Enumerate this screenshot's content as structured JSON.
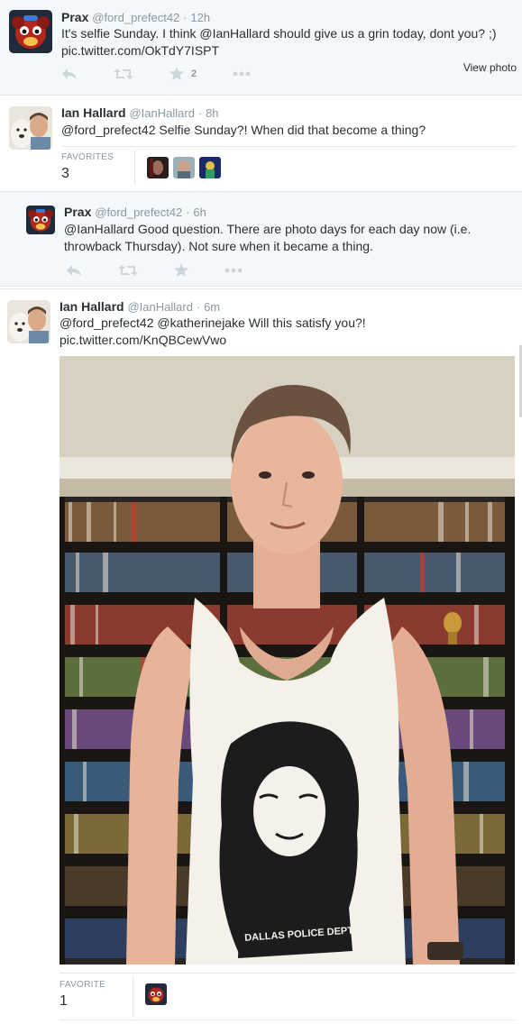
{
  "tweets": [
    {
      "name": "Prax",
      "handle": "@ford_prefect42",
      "sep": "·",
      "time": "12h",
      "text": "It's selfie Sunday. I think @IanHallard should give us a grin today, dont you? ;)",
      "link": "pic.twitter.com/OkTdY7ISPT",
      "favorite_count": "2",
      "view_photo": "View photo"
    },
    {
      "name": "Ian Hallard",
      "handle": "@IanHallard",
      "sep": "·",
      "time": "8h",
      "text": "@ford_prefect42 Selfie Sunday?! When did that become a thing?",
      "stat_label": "FAVORITES",
      "stat_count": "3"
    },
    {
      "name": "Prax",
      "handle": "@ford_prefect42",
      "sep": "·",
      "time": "6h",
      "text_line1": "@IanHallard Good question. There are photo days for each day now (i.e.",
      "text_line2": "throwback Thursday). Not sure when it became a thing."
    },
    {
      "name": "Ian Hallard",
      "handle": "@IanHallard",
      "sep": "·",
      "time": "6m",
      "text": "@ford_prefect42 @katherinejake Will this satisfy you?!",
      "link": "pic.twitter.com/KnQBCewVwo",
      "stat_label": "FAVORITE",
      "stat_count": "1",
      "shirt_text": "DALLAS POLICE DEPT."
    }
  ],
  "icons": [
    "reply-icon",
    "retweet-icon",
    "favorite-icon",
    "more-icon"
  ],
  "colors": {
    "bg_alt": "#f5f8fa",
    "border": "#e1e8ed",
    "muted": "#8899a6",
    "action_gray": "#ccd6dd"
  }
}
